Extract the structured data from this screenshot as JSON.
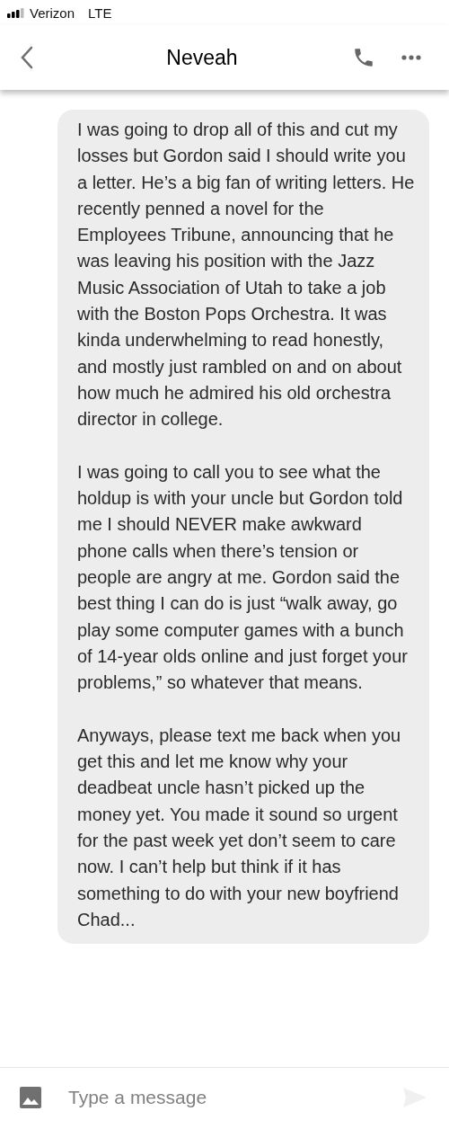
{
  "status_bar": {
    "carrier": "Verizon",
    "network": "LTE"
  },
  "header": {
    "title": "Neveah"
  },
  "message": {
    "paragraphs": [
      "I was going to drop all of this and cut my losses but Gordon said I should write you a letter. He’s a big fan of writing letters. He recently penned a novel for the Employees Tribune, announcing that he was leaving his position with the Jazz Music Association of Utah to take a job with the Boston Pops Orchestra. It was kinda underwhelming to read honestly, and mostly just rambled on and on about how much he admired his old orchestra director in college.",
      "I was going to call you to see what the holdup is with your uncle but Gordon told me I should NEVER make awkward phone calls when there’s tension or people are angry at me. Gordon said the best thing I can do is just “walk away, go play some computer games with a bunch of 14-year olds online and just forget your problems,” so whatever that means.",
      "Anyways, please text me back when you get this and let me know why your deadbeat uncle hasn’t picked up the money yet. You made it sound so urgent for the past week yet don’t seem to care now. I can’t help but think if it has something to do with your new boyfriend Chad..."
    ]
  },
  "composer": {
    "placeholder": "Type a message"
  }
}
